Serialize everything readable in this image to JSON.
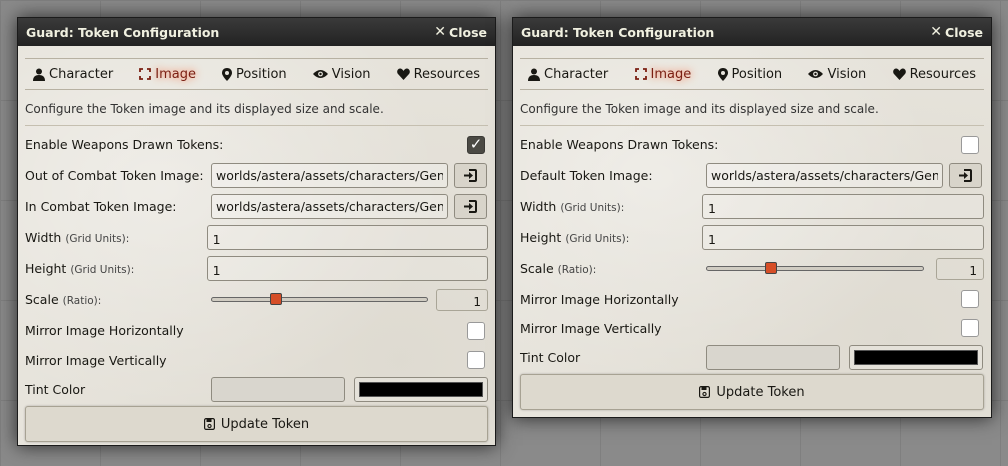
{
  "colors": {
    "accent": "#d64e27",
    "tint_swatch": "#000000",
    "active_tab": "#7a1f12"
  },
  "windows": [
    {
      "title": "Guard: Token Configuration",
      "close_label": "Close",
      "tabs": [
        {
          "label": "Character",
          "icon": "user-icon"
        },
        {
          "label": "Image",
          "icon": "expand-icon",
          "active": true
        },
        {
          "label": "Position",
          "icon": "map-marker-icon"
        },
        {
          "label": "Vision",
          "icon": "eye-icon"
        },
        {
          "label": "Resources",
          "icon": "heart-icon"
        }
      ],
      "hint": "Configure the Token image and its displayed size and scale.",
      "weapons_drawn_label": "Enable Weapons Drawn Tokens:",
      "weapons_drawn_checked": true,
      "image_fields": [
        {
          "label": "Out of Combat Token Image:",
          "value": "worlds/astera/assets/characters/Gene"
        },
        {
          "label": "In Combat Token Image:",
          "value": "worlds/astera/assets/characters/Gene"
        }
      ],
      "width_label": "Width",
      "width_units": "(Grid Units):",
      "width_value": "1",
      "height_label": "Height",
      "height_units": "(Grid Units):",
      "height_value": "1",
      "scale_label": "Scale",
      "scale_units": "(Ratio):",
      "scale_value": "1",
      "scale_fraction": 0.3,
      "mirror_h_label": "Mirror Image Horizontally",
      "mirror_v_label": "Mirror Image Vertically",
      "tint_label": "Tint Color",
      "update_label": "Update Token"
    },
    {
      "title": "Guard: Token Configuration",
      "close_label": "Close",
      "tabs": [
        {
          "label": "Character",
          "icon": "user-icon"
        },
        {
          "label": "Image",
          "icon": "expand-icon",
          "active": true
        },
        {
          "label": "Position",
          "icon": "map-marker-icon"
        },
        {
          "label": "Vision",
          "icon": "eye-icon"
        },
        {
          "label": "Resources",
          "icon": "heart-icon"
        }
      ],
      "hint": "Configure the Token image and its displayed size and scale.",
      "weapons_drawn_label": "Enable Weapons Drawn Tokens:",
      "weapons_drawn_checked": false,
      "image_fields": [
        {
          "label": "Default Token Image:",
          "value": "worlds/astera/assets/characters/Gene"
        }
      ],
      "width_label": "Width",
      "width_units": "(Grid Units):",
      "width_value": "1",
      "height_label": "Height",
      "height_units": "(Grid Units):",
      "height_value": "1",
      "scale_label": "Scale",
      "scale_units": "(Ratio):",
      "scale_value": "1",
      "scale_fraction": 0.3,
      "mirror_h_label": "Mirror Image Horizontally",
      "mirror_v_label": "Mirror Image Vertically",
      "tint_label": "Tint Color",
      "update_label": "Update Token"
    }
  ]
}
